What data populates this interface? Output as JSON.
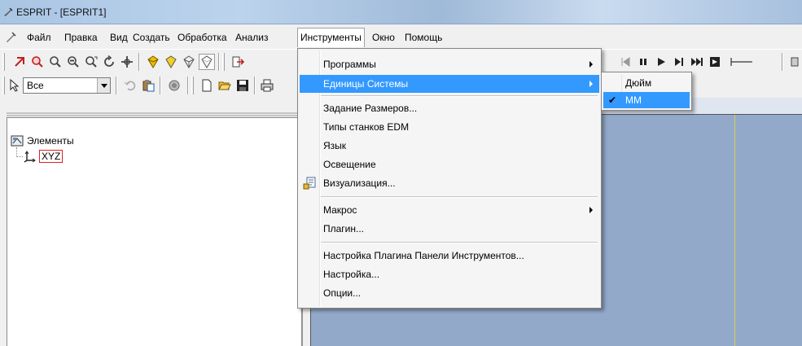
{
  "window": {
    "title": "ESPRIT - [ESPRIT1]"
  },
  "menubar": {
    "items": [
      {
        "label": "Файл"
      },
      {
        "label": "Правка"
      },
      {
        "label": "Вид"
      },
      {
        "label": "Создать"
      },
      {
        "label": "Обработка"
      },
      {
        "label": "Анализ"
      },
      {
        "label": "Инструменты"
      },
      {
        "label": "Окно"
      },
      {
        "label": "Помощь"
      }
    ]
  },
  "toolbar2": {
    "filter_value": "Все"
  },
  "panel": {
    "close_glyph": "x",
    "tree": {
      "root_label": "Элементы",
      "child_label": "XYZ"
    }
  },
  "tools_menu": {
    "items": [
      {
        "label": "Программы",
        "submenu": true
      },
      {
        "label": "Единицы Системы",
        "submenu": true,
        "highlighted": true
      },
      {
        "label": "Задание Размеров..."
      },
      {
        "label": "Типы станков EDM"
      },
      {
        "label": "Язык"
      },
      {
        "label": "Освещение"
      },
      {
        "label": "Визуализация..."
      },
      {
        "label": "Макрос",
        "submenu": true
      },
      {
        "label": "Плагин..."
      },
      {
        "label": "Настройка Плагина Панели Инструментов..."
      },
      {
        "label": "Настройка..."
      },
      {
        "label": "Опции..."
      }
    ]
  },
  "units_submenu": {
    "items": [
      {
        "label": "Дюйм",
        "checked": false
      },
      {
        "label": "ММ",
        "checked": true,
        "highlighted": true
      }
    ],
    "check_glyph": "✔"
  },
  "colors": {
    "highlight": "#3399ff",
    "viewport": "#93a9c9",
    "axis_line": "#d8d050"
  }
}
